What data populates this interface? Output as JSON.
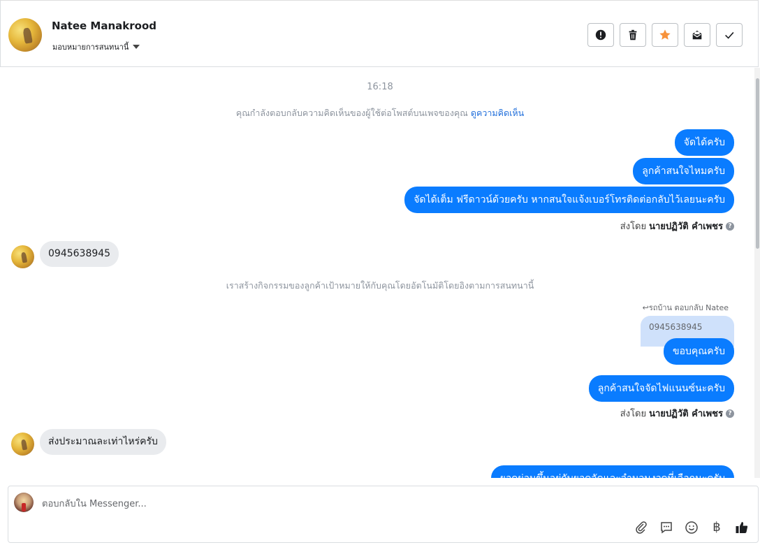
{
  "header": {
    "name": "Natee Manakrood",
    "assign_label": "มอบหมายการสนทนานี้",
    "actions": [
      "alert-icon",
      "trash-icon",
      "star-icon",
      "mark-unread-icon",
      "check-icon"
    ],
    "star_color": "#f7923b"
  },
  "chat": {
    "time": "16:18",
    "comment_note": "คุณกำลังตอบกลับความคิดเห็นของผู้ใช้ต่อโพสต์บนเพจของคุณ",
    "comment_link": "ดูความคิดเห็น",
    "out1": "จัดได้ครับ",
    "out2": "ลูกค้าสนใจไหมครับ",
    "out3": "จัดได้เต็ม ฟรีดาวน์ด้วยครับ หากสนใจแจ้งเบอร์โทรติดต่อกลับไว้เลยนะครับ",
    "sentby_prefix": "ส่งโดย",
    "sentby_name": "นายปฏิวัติ คำเพชร",
    "in1": "0945638945",
    "activity_note": "เราสร้างกิจกรรมของลูกค้าเป้าหมายให้กับคุณโดยอัตโนมัติโดยอิงตามการสนทนานี้",
    "reply_label": "รถบ้าน ตอบกลับ Natee",
    "quoted": "0945638945",
    "out4": "ขอบคุณครับ",
    "out5": "ลูกค้าสนใจจัดไฟแนนซ์นะครับ",
    "sentby2_prefix": "ส่งโดย",
    "sentby2_name": "นายปฏิวัติ คำเพชร",
    "in2": "ส่งประมาณละเท่าไหร่ครับ",
    "out6": "ยอดผ่อนขึ้นอยู่กับยอดจัดและจำนวนงวดที่เลือกนะครับ"
  },
  "composer": {
    "placeholder": "ตอบกลับใน Messenger...",
    "tools": [
      "attach-icon",
      "saved-reply-icon",
      "emoji-icon",
      "baht-icon",
      "like-icon"
    ],
    "baht_symbol": "฿"
  },
  "colors": {
    "accent": "#0a7cff",
    "incoming_bubble": "#e9ebee",
    "link": "#216fdb"
  }
}
